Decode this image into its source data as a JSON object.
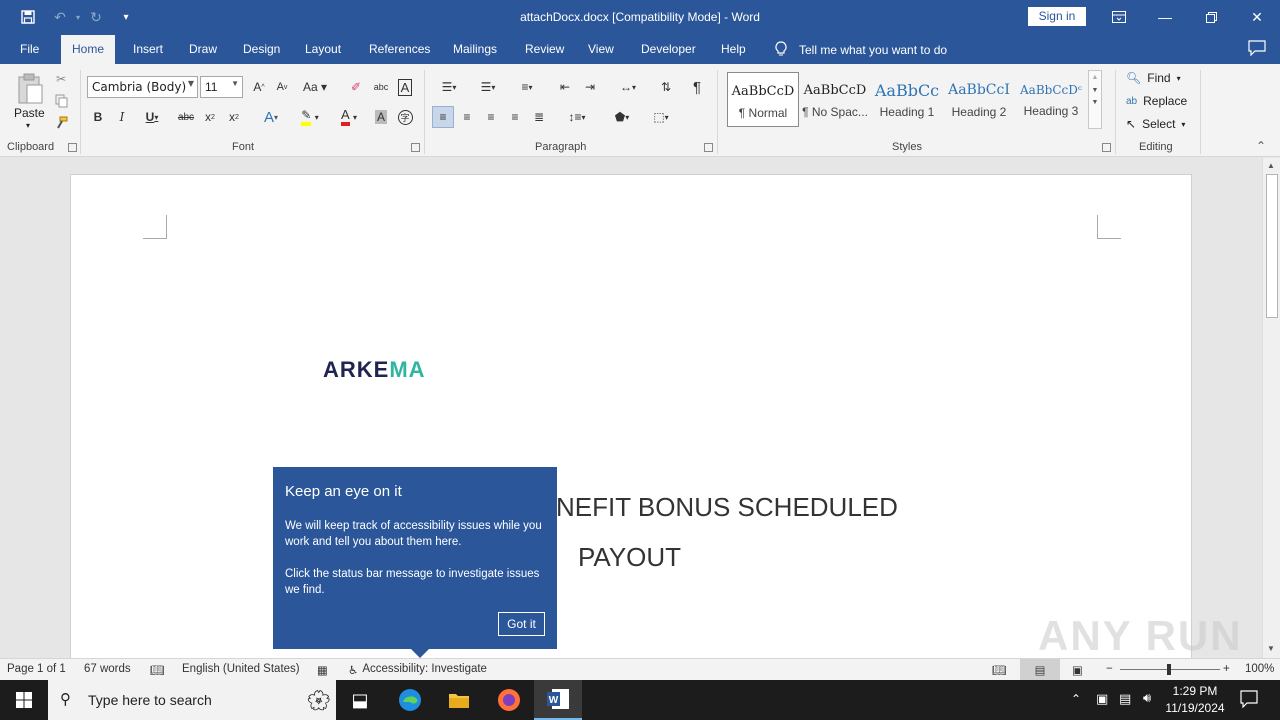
{
  "window": {
    "title": "attachDocx.docx [Compatibility Mode]  -  Word",
    "sign_in": "Sign in"
  },
  "tabs": [
    "File",
    "Home",
    "Insert",
    "Draw",
    "Design",
    "Layout",
    "References",
    "Mailings",
    "Review",
    "View",
    "Developer",
    "Help"
  ],
  "tell_me": "Tell me what you want to do",
  "ribbon": {
    "clipboard": {
      "label": "Clipboard",
      "paste": "Paste"
    },
    "font": {
      "label": "Font",
      "name": "Cambria (Body)",
      "size": "11"
    },
    "paragraph": {
      "label": "Paragraph"
    },
    "styles": {
      "label": "Styles",
      "items": [
        {
          "sample": "AaBbCcD",
          "name": "¶ Normal"
        },
        {
          "sample": "AaBbCcD",
          "name": "¶ No Spac..."
        },
        {
          "sample": "AaBbCc",
          "name": "Heading 1"
        },
        {
          "sample": "AaBbCcI",
          "name": "Heading 2"
        },
        {
          "sample": "AaBbCcDᶜ",
          "name": "Heading 3"
        }
      ]
    },
    "editing": {
      "label": "Editing",
      "find": "Find",
      "replace": "Replace",
      "select": "Select"
    }
  },
  "document": {
    "logo_main": "ARKE",
    "logo_accent": "MA",
    "line1": "NEFIT BONUS SCHEDULED",
    "line2": "PAYOUT"
  },
  "callout": {
    "title": "Keep an eye on it",
    "body1": "We will keep track of accessibility issues while you work and tell you about them here.",
    "body2": "Click the status bar message to investigate issues we find.",
    "button": "Got it"
  },
  "statusbar": {
    "page": "Page 1 of 1",
    "words": "67 words",
    "language": "English (United States)",
    "accessibility": "Accessibility: Investigate",
    "zoom": "100%"
  },
  "taskbar": {
    "search_placeholder": "Type here to search",
    "time": "1:29 PM",
    "date": "11/19/2024"
  },
  "watermark": "ANY RUN",
  "colors": {
    "word_blue": "#2b579a",
    "heading_blue": "#2e74b5",
    "logo_teal": "#2fb5a0",
    "logo_navy": "#1f2451"
  }
}
